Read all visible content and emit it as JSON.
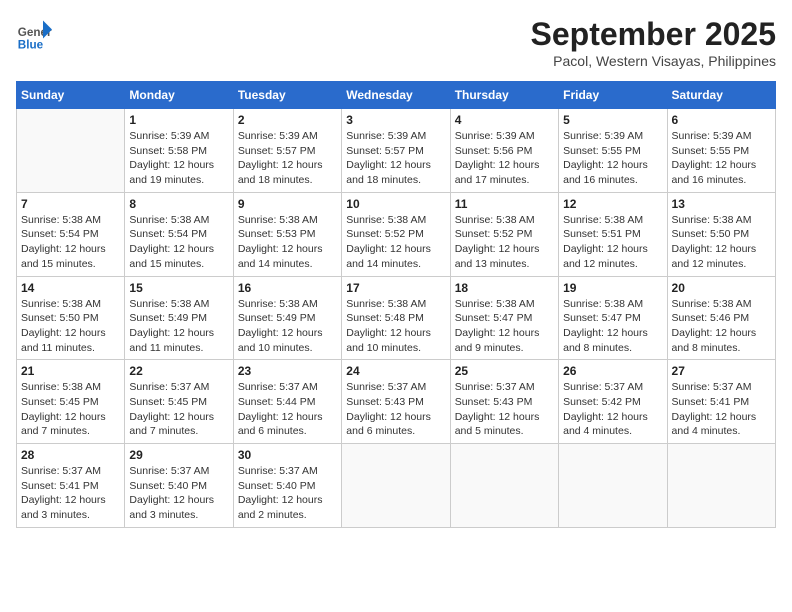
{
  "header": {
    "logo": {
      "general": "General",
      "blue": "Blue"
    },
    "title": "September 2025",
    "subtitle": "Pacol, Western Visayas, Philippines"
  },
  "calendar": {
    "days_of_week": [
      "Sunday",
      "Monday",
      "Tuesday",
      "Wednesday",
      "Thursday",
      "Friday",
      "Saturday"
    ],
    "weeks": [
      [
        {
          "day": "",
          "info": ""
        },
        {
          "day": "1",
          "info": "Sunrise: 5:39 AM\nSunset: 5:58 PM\nDaylight: 12 hours\nand 19 minutes."
        },
        {
          "day": "2",
          "info": "Sunrise: 5:39 AM\nSunset: 5:57 PM\nDaylight: 12 hours\nand 18 minutes."
        },
        {
          "day": "3",
          "info": "Sunrise: 5:39 AM\nSunset: 5:57 PM\nDaylight: 12 hours\nand 18 minutes."
        },
        {
          "day": "4",
          "info": "Sunrise: 5:39 AM\nSunset: 5:56 PM\nDaylight: 12 hours\nand 17 minutes."
        },
        {
          "day": "5",
          "info": "Sunrise: 5:39 AM\nSunset: 5:55 PM\nDaylight: 12 hours\nand 16 minutes."
        },
        {
          "day": "6",
          "info": "Sunrise: 5:39 AM\nSunset: 5:55 PM\nDaylight: 12 hours\nand 16 minutes."
        }
      ],
      [
        {
          "day": "7",
          "info": "Sunrise: 5:38 AM\nSunset: 5:54 PM\nDaylight: 12 hours\nand 15 minutes."
        },
        {
          "day": "8",
          "info": "Sunrise: 5:38 AM\nSunset: 5:54 PM\nDaylight: 12 hours\nand 15 minutes."
        },
        {
          "day": "9",
          "info": "Sunrise: 5:38 AM\nSunset: 5:53 PM\nDaylight: 12 hours\nand 14 minutes."
        },
        {
          "day": "10",
          "info": "Sunrise: 5:38 AM\nSunset: 5:52 PM\nDaylight: 12 hours\nand 14 minutes."
        },
        {
          "day": "11",
          "info": "Sunrise: 5:38 AM\nSunset: 5:52 PM\nDaylight: 12 hours\nand 13 minutes."
        },
        {
          "day": "12",
          "info": "Sunrise: 5:38 AM\nSunset: 5:51 PM\nDaylight: 12 hours\nand 12 minutes."
        },
        {
          "day": "13",
          "info": "Sunrise: 5:38 AM\nSunset: 5:50 PM\nDaylight: 12 hours\nand 12 minutes."
        }
      ],
      [
        {
          "day": "14",
          "info": "Sunrise: 5:38 AM\nSunset: 5:50 PM\nDaylight: 12 hours\nand 11 minutes."
        },
        {
          "day": "15",
          "info": "Sunrise: 5:38 AM\nSunset: 5:49 PM\nDaylight: 12 hours\nand 11 minutes."
        },
        {
          "day": "16",
          "info": "Sunrise: 5:38 AM\nSunset: 5:49 PM\nDaylight: 12 hours\nand 10 minutes."
        },
        {
          "day": "17",
          "info": "Sunrise: 5:38 AM\nSunset: 5:48 PM\nDaylight: 12 hours\nand 10 minutes."
        },
        {
          "day": "18",
          "info": "Sunrise: 5:38 AM\nSunset: 5:47 PM\nDaylight: 12 hours\nand 9 minutes."
        },
        {
          "day": "19",
          "info": "Sunrise: 5:38 AM\nSunset: 5:47 PM\nDaylight: 12 hours\nand 8 minutes."
        },
        {
          "day": "20",
          "info": "Sunrise: 5:38 AM\nSunset: 5:46 PM\nDaylight: 12 hours\nand 8 minutes."
        }
      ],
      [
        {
          "day": "21",
          "info": "Sunrise: 5:38 AM\nSunset: 5:45 PM\nDaylight: 12 hours\nand 7 minutes."
        },
        {
          "day": "22",
          "info": "Sunrise: 5:37 AM\nSunset: 5:45 PM\nDaylight: 12 hours\nand 7 minutes."
        },
        {
          "day": "23",
          "info": "Sunrise: 5:37 AM\nSunset: 5:44 PM\nDaylight: 12 hours\nand 6 minutes."
        },
        {
          "day": "24",
          "info": "Sunrise: 5:37 AM\nSunset: 5:43 PM\nDaylight: 12 hours\nand 6 minutes."
        },
        {
          "day": "25",
          "info": "Sunrise: 5:37 AM\nSunset: 5:43 PM\nDaylight: 12 hours\nand 5 minutes."
        },
        {
          "day": "26",
          "info": "Sunrise: 5:37 AM\nSunset: 5:42 PM\nDaylight: 12 hours\nand 4 minutes."
        },
        {
          "day": "27",
          "info": "Sunrise: 5:37 AM\nSunset: 5:41 PM\nDaylight: 12 hours\nand 4 minutes."
        }
      ],
      [
        {
          "day": "28",
          "info": "Sunrise: 5:37 AM\nSunset: 5:41 PM\nDaylight: 12 hours\nand 3 minutes."
        },
        {
          "day": "29",
          "info": "Sunrise: 5:37 AM\nSunset: 5:40 PM\nDaylight: 12 hours\nand 3 minutes."
        },
        {
          "day": "30",
          "info": "Sunrise: 5:37 AM\nSunset: 5:40 PM\nDaylight: 12 hours\nand 2 minutes."
        },
        {
          "day": "",
          "info": ""
        },
        {
          "day": "",
          "info": ""
        },
        {
          "day": "",
          "info": ""
        },
        {
          "day": "",
          "info": ""
        }
      ]
    ]
  }
}
